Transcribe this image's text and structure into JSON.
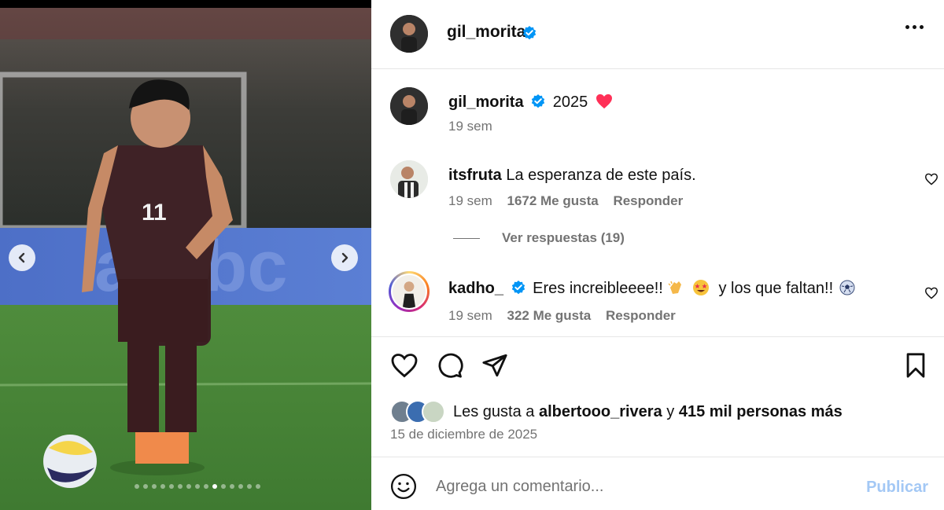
{
  "post": {
    "author": "gil_morita",
    "verified": true,
    "image_alt": "photo of a football player in a dark Mexico jersey number 11 dribbling a ball on a pitch",
    "carousel": {
      "total_slides": 15,
      "active_index": 9
    }
  },
  "caption": {
    "username": "gil_morita",
    "text": "2025",
    "emoji": "heart",
    "time": "19 sem"
  },
  "comments": [
    {
      "username": "itsfruta",
      "text": "La esperanza de este país.",
      "time": "19 sem",
      "likes": "1672 Me gusta",
      "reply_label": "Responder",
      "view_replies": "Ver respuestas (19)"
    },
    {
      "username": "kadho_",
      "verified": true,
      "text_before": "Eres increibleeee!!",
      "text_middle": "y los que faltan!!",
      "time": "19 sem",
      "likes": "322 Me gusta",
      "reply_label": "Responder"
    }
  ],
  "likes": {
    "prefix": "Les gusta a",
    "user": "albertooo_rivera",
    "connector": "y",
    "count": "415 mil personas más"
  },
  "date": "15 de diciembre de 2025",
  "composer": {
    "placeholder": "Agrega un comentario...",
    "publish_label": "Publicar"
  },
  "colors": {
    "verified_blue": "#0095f6",
    "publish_disabled": "#a3c8f5",
    "secondary_text": "#737373",
    "heart_red": "#ff3040"
  }
}
